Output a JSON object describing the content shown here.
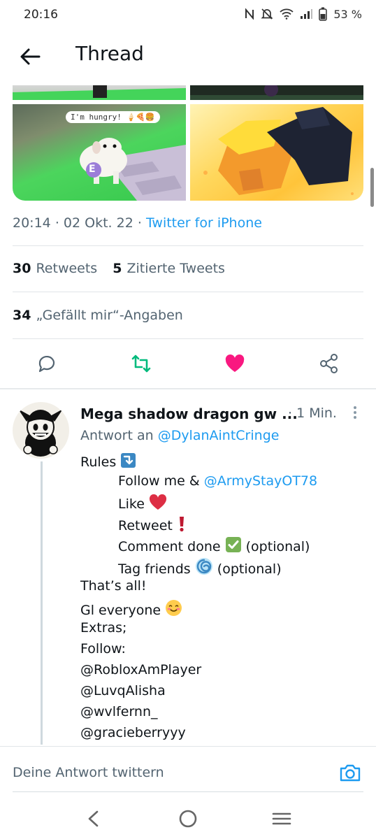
{
  "status_bar": {
    "time": "20:16",
    "battery": "53 %"
  },
  "header": {
    "title": "Thread"
  },
  "media": {
    "speech_bubble": "I'm hungry! 🍦🍕🍔",
    "badge_letter": "E"
  },
  "tweet": {
    "time": "20:14",
    "date": "02 Okt. 22",
    "source": "Twitter for iPhone",
    "retweets_count": "30",
    "retweets_label": "Retweets",
    "quotes_count": "5",
    "quotes_label": "Zitierte Tweets",
    "likes_count": "34",
    "likes_label": "„Gefällt mir“-Angaben"
  },
  "reply": {
    "name": "Mega shadow dragon gw ...",
    "time": "· 1 Min.",
    "reply_to_label": "Antwort an",
    "reply_to_handle": "@DylanAintCringe",
    "lines": {
      "rules": "Rules",
      "follow_prefix": "Follow me & ",
      "follow_handle": "@ArmyStayOT78",
      "like": "Like",
      "retweet": "Retweet",
      "comment_prefix": "Comment done",
      "comment_suffix": "(optional)",
      "tag_prefix": "Tag friends",
      "tag_suffix": "(optional)",
      "thats_all": "That’s all!",
      "gl": "Gl everyone",
      "extras": "Extras;",
      "follow_label": "Follow:",
      "handle1": "@RobloxAmPlayer",
      "handle2": "@LuvqAlisha",
      "handle3": "@wvlfernn_",
      "handle4": "@gracieberryyy"
    }
  },
  "compose": {
    "placeholder": "Deine Antwort twittern"
  },
  "icons": {
    "back": "arrow-left-icon",
    "reply": "comment-bubble-icon",
    "retweet": "retweet-icon",
    "like": "heart-icon",
    "share": "share-icon",
    "more": "kebab-menu-icon",
    "camera": "camera-icon",
    "nav_back": "chevron-left-icon",
    "nav_home": "circle-home-icon",
    "nav_recents": "menu-lines-icon"
  },
  "colors": {
    "link": "#1d9bf0",
    "retweet": "#00ba7c",
    "like": "#f91880",
    "text": "#0f1419",
    "secondary": "#536471",
    "divider": "#e1e5e8"
  }
}
